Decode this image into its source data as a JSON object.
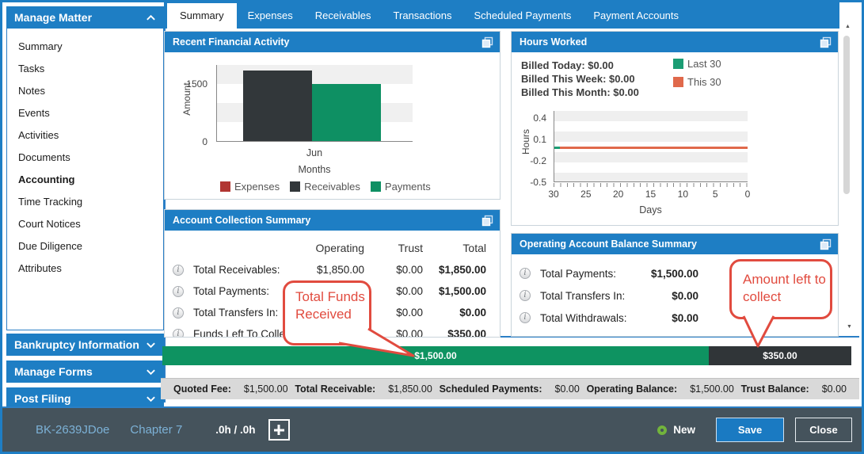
{
  "sidebar": {
    "sections": [
      {
        "label": "Manage Matter",
        "state": "expanded"
      },
      {
        "label": "Bankruptcy Information",
        "state": "collapsed"
      },
      {
        "label": "Manage Forms",
        "state": "collapsed"
      },
      {
        "label": "Post Filing",
        "state": "collapsed"
      }
    ],
    "items": [
      "Summary",
      "Tasks",
      "Notes",
      "Events",
      "Activities",
      "Documents",
      "Accounting",
      "Time Tracking",
      "Court Notices",
      "Due Diligence",
      "Attributes"
    ],
    "active_item": "Accounting"
  },
  "tabs": [
    "Summary",
    "Expenses",
    "Receivables",
    "Transactions",
    "Scheduled Payments",
    "Payment Accounts"
  ],
  "active_tab": "Summary",
  "panels": {
    "financial_activity": {
      "title": "Recent Financial Activity"
    },
    "hours_worked": {
      "title": "Hours Worked",
      "billed": [
        {
          "label": "Billed Today:",
          "value": "$0.00"
        },
        {
          "label": "Billed This Week:",
          "value": "$0.00"
        },
        {
          "label": "Billed This Month:",
          "value": "$0.00"
        }
      ]
    },
    "account_collection": {
      "title": "Account Collection Summary",
      "columns": [
        "Operating",
        "Trust",
        "Total"
      ],
      "rows": [
        {
          "label": "Total Receivables:",
          "operating": "$1,850.00",
          "trust": "$0.00",
          "total": "$1,850.00"
        },
        {
          "label": "Total Payments:",
          "operating": "",
          "trust": "$0.00",
          "total": "$1,500.00"
        },
        {
          "label": "Total Transfers In:",
          "operating": "",
          "trust": "$0.00",
          "total": "$0.00"
        },
        {
          "label": "Funds Left To Collect:",
          "operating": "",
          "trust": "$0.00",
          "total": "$350.00"
        }
      ]
    },
    "operating_balance": {
      "title": "Operating Account Balance Summary",
      "rows": [
        {
          "label": "Total Payments:",
          "value": "$1,500.00"
        },
        {
          "label": "Total Transfers In:",
          "value": "$0.00"
        },
        {
          "label": "Total Withdrawals:",
          "value": "$0.00"
        }
      ]
    }
  },
  "chart_data": [
    {
      "type": "bar",
      "title": "Recent Financial Activity",
      "categories": [
        "Jun"
      ],
      "series": [
        {
          "name": "Expenses",
          "values": [
            0
          ],
          "color": "#b13632"
        },
        {
          "name": "Receivables",
          "values": [
            1850
          ],
          "color": "#32373a"
        },
        {
          "name": "Payments",
          "values": [
            1500
          ],
          "color": "#0e9063"
        }
      ],
      "xlabel": "Months",
      "ylabel": "Amount",
      "ylim": [
        0,
        2000
      ],
      "yticks": [
        0,
        1500
      ],
      "legend_position": "bottom",
      "grid": "striped"
    },
    {
      "type": "line",
      "title": "Hours Worked",
      "xticks": [
        30,
        25,
        20,
        15,
        10,
        5,
        0
      ],
      "series": [
        {
          "name": "Last 30",
          "values": [
            0,
            0,
            0,
            0,
            0,
            0,
            0
          ],
          "color": "#1b9d74"
        },
        {
          "name": "This 30",
          "values": [
            0,
            0,
            0,
            0,
            0,
            0,
            0
          ],
          "color": "#e0694b"
        }
      ],
      "xlabel": "Days",
      "ylabel": "Hours",
      "ylim": [
        -0.5,
        0.5
      ],
      "yticks": [
        0.4,
        0.1,
        -0.2,
        -0.5
      ],
      "legend_position": "top-right",
      "grid": "striped"
    }
  ],
  "collection_bar": {
    "collected": "$1,500.00",
    "collected_pct": 79.3,
    "collected_color": "#0e9361",
    "remaining": "$350.00",
    "remaining_pct": 20.7,
    "remaining_color": "#303538"
  },
  "callouts": [
    {
      "text": "Total Funds Received"
    },
    {
      "text": "Amount left to collect"
    }
  ],
  "summary_strip": [
    {
      "label": "Quoted Fee:",
      "value": "$1,500.00"
    },
    {
      "label": "Total Receivable:",
      "value": "$1,850.00"
    },
    {
      "label": "Scheduled Payments:",
      "value": "$0.00"
    },
    {
      "label": "Operating Balance:",
      "value": "$1,500.00"
    },
    {
      "label": "Trust Balance:",
      "value": "$0.00"
    }
  ],
  "footer": {
    "matter_id": "BK-2639JDoe",
    "chapter": "Chapter 7",
    "hours": ".0h / .0h",
    "new_label": "New",
    "save_label": "Save",
    "close_label": "Close"
  }
}
